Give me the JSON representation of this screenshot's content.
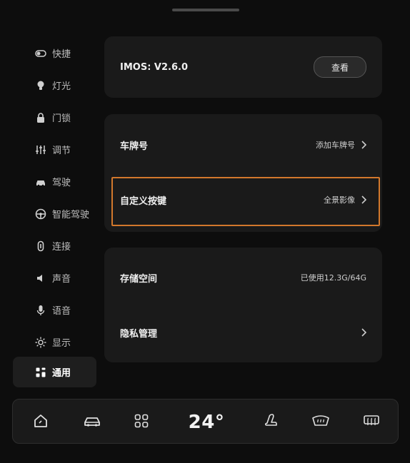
{
  "sidebar": {
    "items": [
      {
        "label": "快捷",
        "icon": "toggle-icon",
        "active": false
      },
      {
        "label": "灯光",
        "icon": "lightbulb-icon",
        "active": false
      },
      {
        "label": "门锁",
        "icon": "lock-icon",
        "active": false
      },
      {
        "label": "调节",
        "icon": "sliders-icon",
        "active": false
      },
      {
        "label": "驾驶",
        "icon": "car-icon",
        "active": false
      },
      {
        "label": "智能驾驶",
        "icon": "steering-wheel-icon",
        "active": false
      },
      {
        "label": "连接",
        "icon": "link-icon",
        "active": false
      },
      {
        "label": "声音",
        "icon": "speaker-icon",
        "active": false
      },
      {
        "label": "语音",
        "icon": "microphone-icon",
        "active": false
      },
      {
        "label": "显示",
        "icon": "brightness-icon",
        "active": false
      },
      {
        "label": "通用",
        "icon": "grid-icon",
        "active": true
      }
    ]
  },
  "version_card": {
    "label": "IMOS: V2.6.0",
    "button_label": "查看"
  },
  "vehicle_card": {
    "plate": {
      "label": "车牌号",
      "value": "添加车牌号"
    },
    "custom_key": {
      "label": "自定义按键",
      "value": "全景影像"
    }
  },
  "storage_card": {
    "storage": {
      "label": "存储空间",
      "value": "已使用12.3G/64G"
    },
    "privacy": {
      "label": "隐私管理"
    }
  },
  "dock": {
    "temperature": "24°",
    "icons": [
      "home-icon",
      "car-icon",
      "apps-icon",
      "seat-icon",
      "windshield-defrost-icon",
      "rear-defrost-icon"
    ]
  },
  "colors": {
    "background": "#0d0d0d",
    "card": "#1a1a1a",
    "highlight": "#d2782c"
  }
}
